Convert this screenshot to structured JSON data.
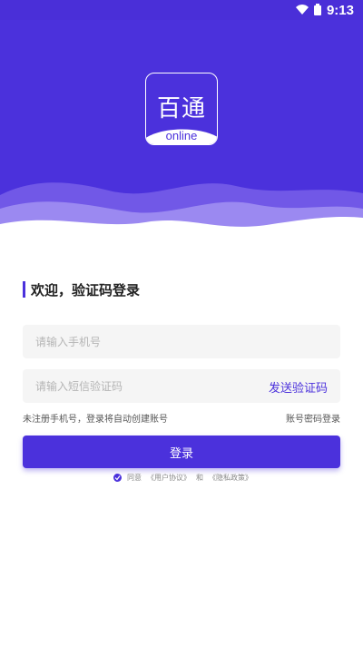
{
  "status_bar": {
    "time": "9:13",
    "wifi_icon": "wifi-icon",
    "battery_icon": "battery-icon"
  },
  "logo": {
    "title": "百通",
    "subtitle": "online"
  },
  "welcome": {
    "title": "欢迎，验证码登录"
  },
  "phone_field": {
    "placeholder": "请输入手机号",
    "value": ""
  },
  "code_field": {
    "placeholder": "请输入短信验证码",
    "value": "",
    "send_label": "发送验证码"
  },
  "hints": {
    "left": "未注册手机号，登录将自动创建账号",
    "right": "账号密码登录"
  },
  "login": {
    "label": "登录"
  },
  "agreement": {
    "agree": "同意",
    "user_agreement": "《用户协议》",
    "and": "和",
    "privacy": "《隐私政策》"
  },
  "colors": {
    "accent": "#4b31dc",
    "field_bg": "#f5f5f5"
  }
}
